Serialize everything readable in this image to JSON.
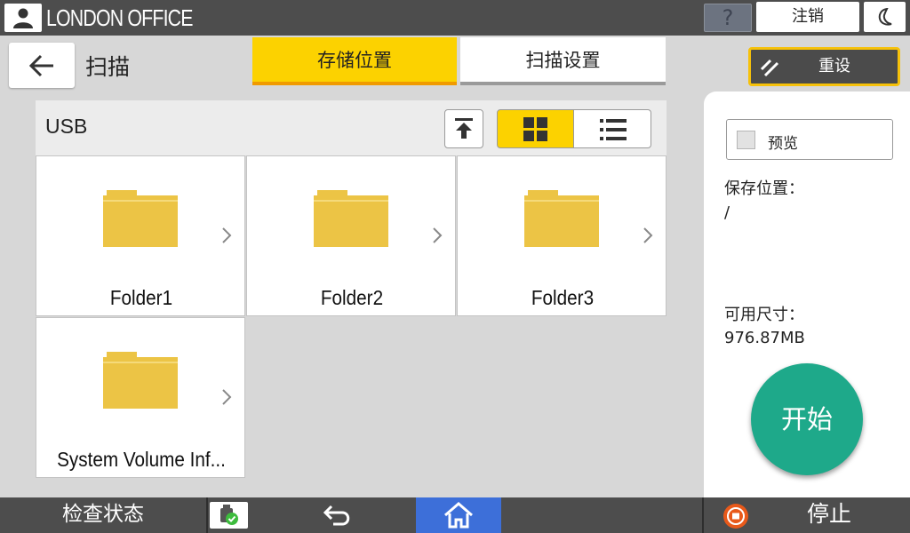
{
  "topbar": {
    "office_name": "LONDON OFFICE",
    "help_label": "?",
    "logout_label": "注销"
  },
  "header": {
    "title": "扫描",
    "tabs": [
      {
        "label": "存储位置",
        "active": true
      },
      {
        "label": "扫描设置",
        "active": false
      }
    ],
    "reset_label": "重设"
  },
  "browser": {
    "location_label": "USB",
    "view_mode": "grid",
    "folders": [
      {
        "name": "Folder1"
      },
      {
        "name": "Folder2"
      },
      {
        "name": "Folder3"
      },
      {
        "name": "System Volume Inf..."
      }
    ]
  },
  "side": {
    "preview_label": "预览",
    "save_location_label": "保存位置：",
    "save_location_value": "/",
    "available_size_label": "可用尺寸：",
    "available_size_value": "976.87MB",
    "start_label": "开始"
  },
  "bottombar": {
    "status_label": "检查状态",
    "stop_label": "停止"
  },
  "colors": {
    "accent_yellow": "#fcd200",
    "tab_underline": "#f09a00",
    "start_green": "#1ea98a",
    "home_blue": "#3d6fd9",
    "folder_yellow": "#ecc445",
    "stop_orange": "#e8591a"
  }
}
